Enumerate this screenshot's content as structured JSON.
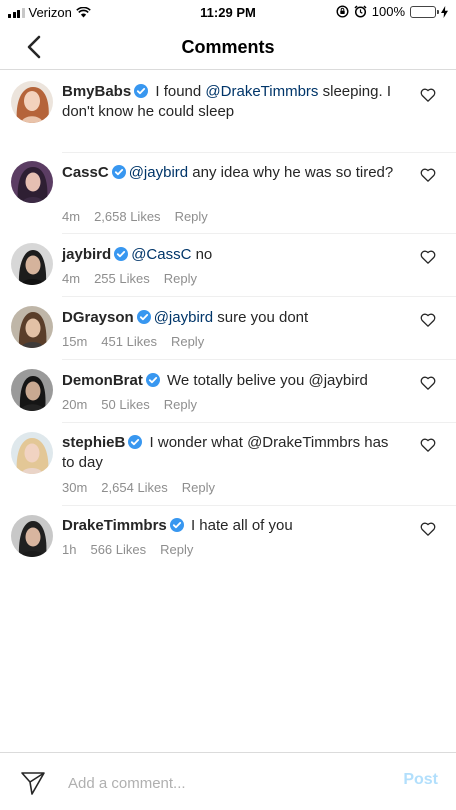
{
  "status_bar": {
    "carrier": "Verizon",
    "time": "11:29 PM",
    "battery": "100%",
    "battery_color": "#f5c400"
  },
  "nav": {
    "title": "Comments",
    "back_icon": "chevron-left-icon"
  },
  "comments": [
    {
      "user": "BmyBabs",
      "parts": [
        " I found ",
        "@DrakeTimmbrs",
        " sleeping. I don't know he could sleep"
      ],
      "time": "",
      "likes": "",
      "reply": ""
    },
    {
      "user": "CassC",
      "parts": [
        "",
        "@jaybird",
        " any idea why he was so tired?"
      ],
      "time": "4m",
      "likes": "2,658 Likes",
      "reply": "Reply"
    },
    {
      "user": "jaybird",
      "parts": [
        "",
        "@CassC",
        " no"
      ],
      "time": "4m",
      "likes": "255 Likes",
      "reply": "Reply"
    },
    {
      "user": "DGrayson",
      "parts": [
        "",
        "@jaybird",
        " sure you dont"
      ],
      "time": "15m",
      "likes": "451 Likes",
      "reply": "Reply"
    },
    {
      "user": "DemonBrat",
      "parts": [
        " We totally belive you @jaybird",
        "",
        ""
      ],
      "time": "20m",
      "likes": "50 Likes",
      "reply": "Reply"
    },
    {
      "user": "stephieB",
      "parts": [
        " I wonder what @DrakeTimmbrs has to day",
        "",
        ""
      ],
      "time": "30m",
      "likes": "2,654 Likes",
      "reply": "Reply"
    },
    {
      "user": "DrakeTimmbrs",
      "parts": [
        " I hate all of you",
        "",
        ""
      ],
      "time": "1h",
      "likes": "566 Likes",
      "reply": "Reply"
    }
  ],
  "composer": {
    "placeholder": "Add a comment...",
    "post_label": "Post",
    "post_color": "#b2dffc"
  },
  "colors": {
    "mention": "#003569",
    "verified": "#3897f0",
    "meta": "#8e8e8e"
  }
}
